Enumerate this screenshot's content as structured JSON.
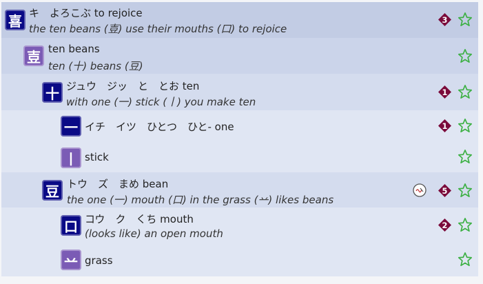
{
  "rows": [
    {
      "kanji": "喜",
      "reading": "キ　よろこぶ to rejoice",
      "mnemonic": "the ten beans (壴) use their mouths (口) to rejoice",
      "badge": "3"
    },
    {
      "kanji": "壴",
      "reading": "ten beans",
      "mnemonic": "ten (十) beans (豆)",
      "badge": ""
    },
    {
      "kanji": "十",
      "reading": "ジュウ　ジッ　と　とお ten",
      "mnemonic": "with one (一) stick (丨) you make ten",
      "badge": "1"
    },
    {
      "kanji": "一",
      "reading": "イチ　イツ　ひとつ　ひと- one",
      "mnemonic": "",
      "badge": "1"
    },
    {
      "kanji": "丨",
      "reading": "stick",
      "mnemonic": "",
      "badge": ""
    },
    {
      "kanji": "豆",
      "reading": "トウ　ズ　まめ bean",
      "mnemonic": "the one (一) mouth (口) in the grass (䒑) likes beans",
      "badge": "5"
    },
    {
      "kanji": "口",
      "reading": "コウ　ク　くち mouth",
      "mnemonic": "(looks like) an open mouth",
      "badge": "2"
    },
    {
      "kanji": "䒑",
      "reading": "grass",
      "mnemonic": "",
      "badge": ""
    }
  ],
  "colors": {
    "navy_box": "#0a0a86",
    "purple_box": "#7b5bb5",
    "badge": "#7a0a3a",
    "star": "#3cb043"
  },
  "icons": {
    "favorite": "star-outline-icon",
    "frequency": "diamond-badge-icon",
    "audio": "sound-icon"
  }
}
